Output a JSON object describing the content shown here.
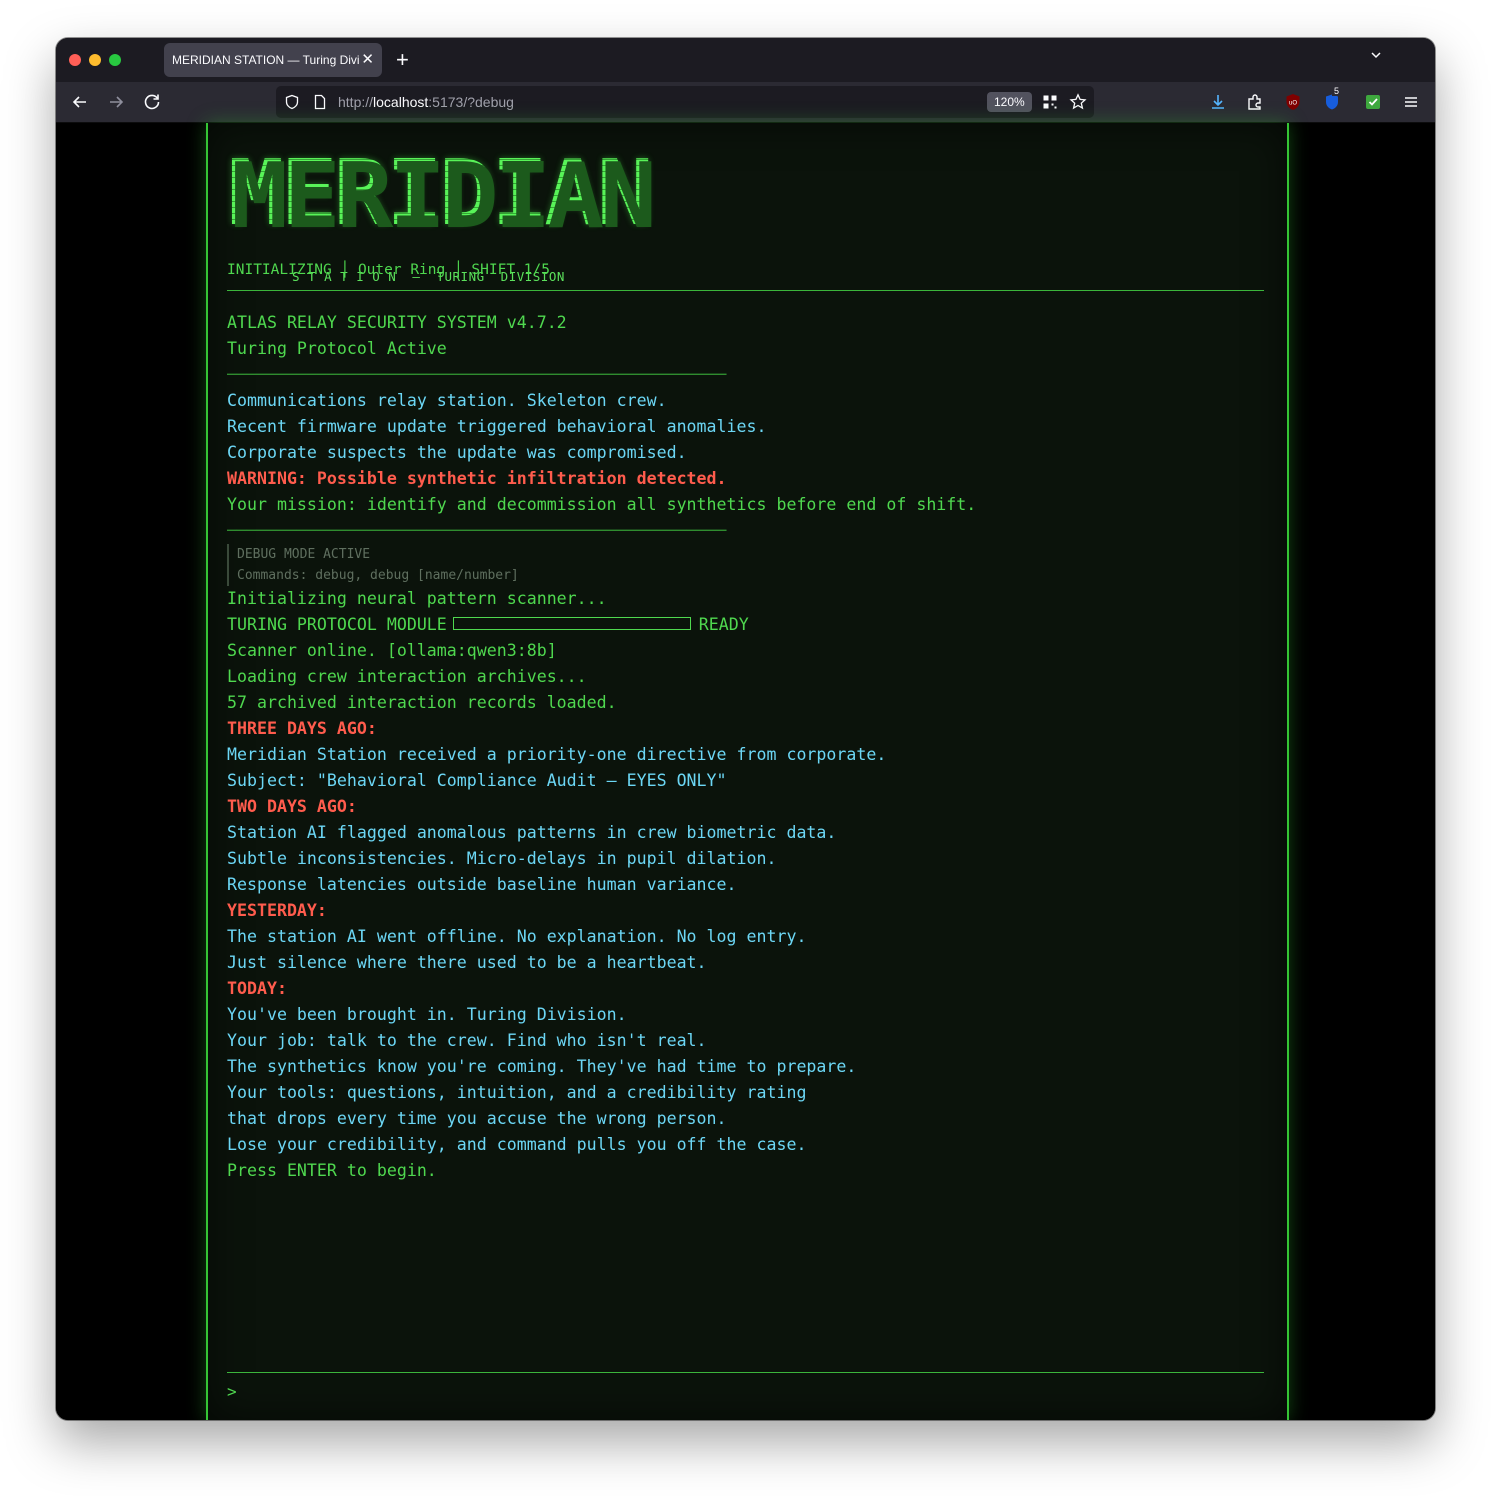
{
  "browser": {
    "tab_title": "MERIDIAN STATION — Turing Division",
    "url_scheme": "http://",
    "url_host": "localhost",
    "url_rest": ":5173/?debug",
    "zoom": "120%",
    "extension_badge": "5"
  },
  "header": {
    "logo": "MERIDIAN",
    "subtitle": "S T A T I O N  —  TURING  DIVISION",
    "status": "INITIALIZING │ Outer Ring │ SHIFT 1/5"
  },
  "log": {
    "system_title": "ATLAS RELAY SECURITY SYSTEM v4.7.2",
    "protocol": "Turing Protocol Active",
    "divider": "──────────────────────────────────────────────────",
    "intro": [
      "Communications relay station. Skeleton crew.",
      "Recent firmware update triggered behavioral anomalies.",
      "Corporate suspects the update was compromised."
    ],
    "warning": "WARNING: Possible synthetic infiltration detected.",
    "mission": "Your mission: identify and decommission all synthetics before end of shift.",
    "debug_mode": "DEBUG MODE ACTIVE",
    "debug_commands": "Commands: debug, debug [name/number]",
    "init_scanner": "Initializing neural pattern scanner...",
    "module_label": "TURING PROTOCOL MODULE",
    "module_progress": 0,
    "module_status": "READY",
    "scanner_online": "Scanner online. [ollama:qwen3:8b]",
    "loading_archives": "Loading crew interaction archives...",
    "records_loaded": "57 archived interaction records loaded.",
    "three_days_label": "THREE DAYS AGO:",
    "three_days": [
      "Meridian Station received a priority-one directive from corporate.",
      "Subject: \"Behavioral Compliance Audit — EYES ONLY\""
    ],
    "two_days_label": "TWO DAYS AGO:",
    "two_days": [
      "Station AI flagged anomalous patterns in crew biometric data.",
      "Subtle inconsistencies. Micro-delays in pupil dilation.",
      "Response latencies outside baseline human variance."
    ],
    "yesterday_label": "YESTERDAY:",
    "yesterday": [
      "The station AI went offline. No explanation. No log entry.",
      "Just silence where there used to be a heartbeat."
    ],
    "today_label": "TODAY:",
    "today": [
      "You've been brought in. Turing Division.",
      "Your job: talk to the crew. Find who isn't real.",
      "The synthetics know you're coming. They've had time to prepare.",
      "Your tools: questions, intuition, and a credibility rating",
      "that drops every time you accuse the wrong person.",
      "Lose your credibility, and command pulls you off the case."
    ],
    "press_enter": "Press ENTER to begin."
  },
  "input": {
    "prompt": ">",
    "value": ""
  },
  "colors": {
    "terminal_green": "#4fd84f",
    "text_cyan": "#6cd7f5",
    "alert_red": "#ff5c4d",
    "border_green": "#35c535"
  }
}
